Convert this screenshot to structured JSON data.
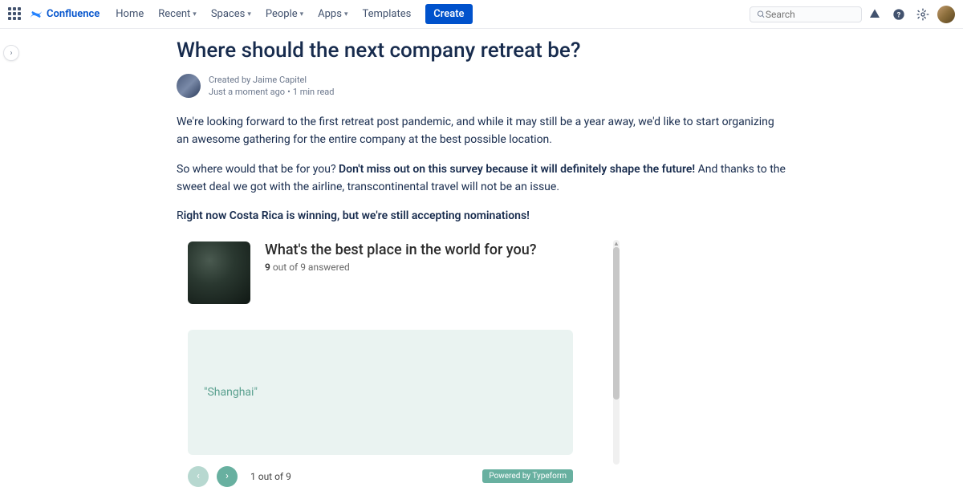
{
  "nav": {
    "product": "Confluence",
    "home": "Home",
    "recent": "Recent",
    "spaces": "Spaces",
    "people": "People",
    "apps": "Apps",
    "templates": "Templates",
    "create": "Create"
  },
  "search": {
    "placeholder": "Search"
  },
  "page": {
    "title": "Where should the next company retreat be?",
    "author_prefix": "Created by ",
    "author": "Jaime Capitel",
    "modified": "Just a moment ago",
    "read_time": "1 min read"
  },
  "body": {
    "p1": "We're looking forward to the first retreat post pandemic, and while it may still be a year away, we'd like to start organizing an awesome gathering for the entire company at the best possible location.",
    "p2_a": "So where would that be for you? ",
    "p2_b": "Don't miss out on this survey because it will definitely shape the future!",
    "p2_c": " And thanks to the sweet deal we got with the airline, transcontinental travel will not be an issue.",
    "p3_a": "R",
    "p3_b": "ight now Costa Rica is winning, but we're still accepting nominations!"
  },
  "survey": {
    "question": "What's the best place in the world for you?",
    "answered_count": "9",
    "answered_suffix": " out of 9 answered",
    "answer": "\"Shanghai\"",
    "footer_count": "1 out of 9",
    "powered": "Powered by Typeform"
  }
}
